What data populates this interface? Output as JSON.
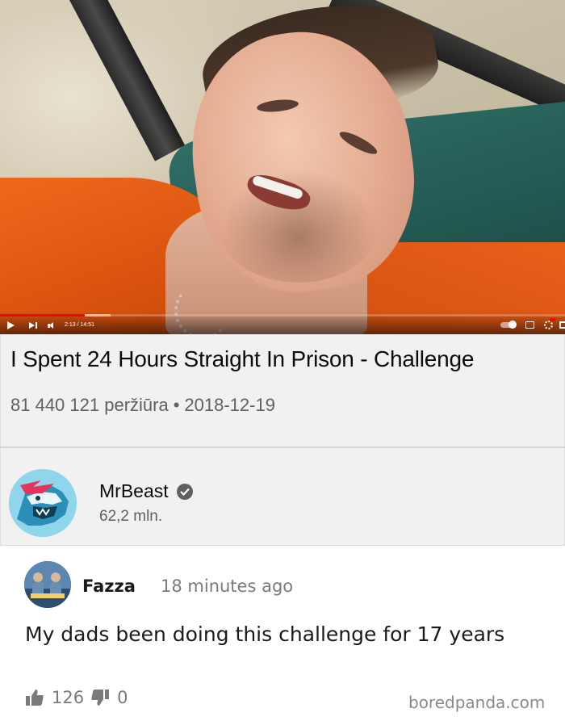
{
  "player": {
    "time_display": "2:13 / 14:51",
    "progress_played": 0.15,
    "progress_loaded": 0.195,
    "icons": [
      "play-icon",
      "next-icon",
      "volume-icon",
      "autoplay-toggle",
      "captions-icon",
      "settings-icon",
      "fullscreen-icon"
    ],
    "accent_color": "#ff0000"
  },
  "video": {
    "title": "I Spent 24 Hours Straight In Prison - Challenge",
    "views": "81 440 121 peržiūra",
    "separator": "•",
    "date": "2018-12-19"
  },
  "channel": {
    "name": "MrBeast",
    "subscribers": "62,2 mln.",
    "verified": true,
    "avatar_color": "#8fd6ec"
  },
  "comment": {
    "author": "Fazza",
    "time": "18 minutes ago",
    "text": "My dads been doing this challenge for 17 years",
    "likes": "126",
    "dislikes": "0"
  },
  "watermark": "boredpanda.com"
}
